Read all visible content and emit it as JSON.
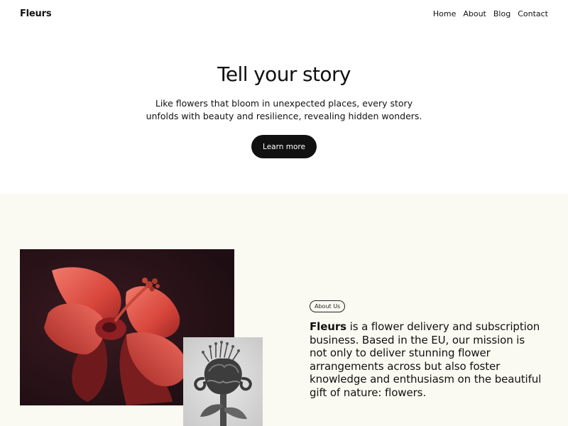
{
  "header": {
    "site_title": "Fleurs",
    "nav": [
      "Home",
      "About",
      "Blog",
      "Contact"
    ]
  },
  "hero": {
    "title": "Tell your story",
    "text_line1": "Like flowers that bloom in unexpected places, every story",
    "text_line2": "unfolds with beauty and resilience, revealing hidden wonders.",
    "button_label": "Learn more"
  },
  "about": {
    "badge": "About Us",
    "brand": "Fleurs",
    "text": " is a flower delivery and subscription business. Based in the EU, our mission is not only to deliver stunning flower arrangements across but also foster knowledge and enthusiasm on the beautiful gift of nature: flowers.",
    "images": [
      "red-hibiscus-photo",
      "monochrome-flower-photo"
    ]
  },
  "colors": {
    "button_bg": "#111111",
    "section_bg": "#fbfaf2",
    "photo_bg": "#241217",
    "petal_red": "#d9463c"
  }
}
